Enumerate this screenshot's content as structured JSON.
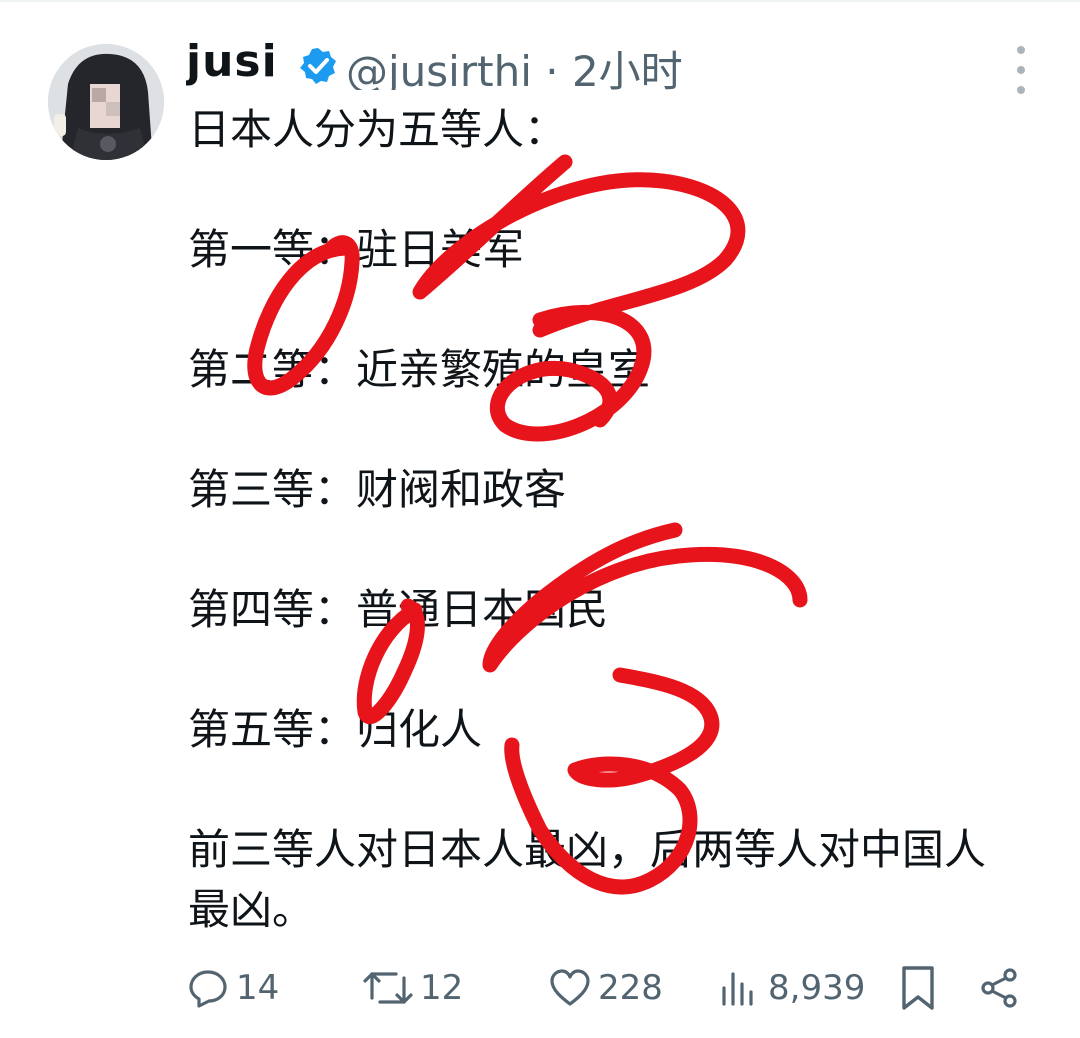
{
  "tweet": {
    "author": {
      "display_name": "jusi",
      "handle": "@jusirthi",
      "time": "2小时"
    },
    "text_lines": [
      "日本人分为五等人：",
      "",
      "第一等：驻日美军",
      "",
      "第二等：近亲繁殖的皇室",
      "",
      "第三等：财阀和政客",
      "",
      "第四等：普通日本国民",
      "",
      "第五等：归化人",
      "",
      "前三等人对日本人最凶，后两等人对中国人",
      "最凶。"
    ],
    "stats": {
      "replies": "14",
      "retweets": "12",
      "likes": "228",
      "views": "8,939"
    }
  },
  "colors": {
    "text": "#0f1419",
    "secondary": "#536471",
    "verified": "#1d9bf0",
    "scribble": "#e8141c"
  },
  "icons": {
    "reply": "reply-icon",
    "retweet": "retweet-icon",
    "like": "heart-icon",
    "views": "views-icon",
    "bookmark": "bookmark-icon",
    "share": "share-icon",
    "more": "more-icon"
  }
}
